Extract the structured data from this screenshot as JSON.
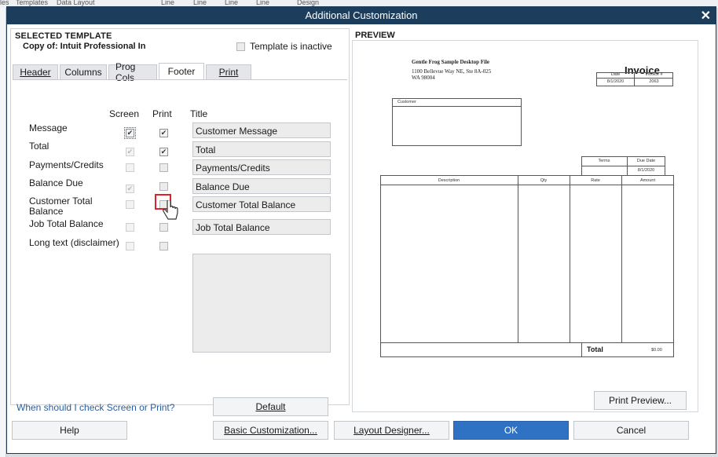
{
  "background_app": {
    "menu_items": [
      "les",
      "Templates",
      "Data Layout",
      "Line",
      "Line",
      "Line",
      "Line"
    ],
    "design_label": "Design"
  },
  "dialog": {
    "title": "Additional Customization",
    "close_glyph": "✕"
  },
  "selected_template": {
    "heading": "SELECTED TEMPLATE",
    "copy_of": "Copy of: Intuit Professional In",
    "inactive_label": "Template is inactive",
    "inactive_checked": false
  },
  "tabs": [
    {
      "label": "Header",
      "active": false
    },
    {
      "label": "Columns",
      "active": false
    },
    {
      "label": "Prog Cols",
      "active": false
    },
    {
      "label": "Footer",
      "active": true
    },
    {
      "label": "Print",
      "active": false
    }
  ],
  "footer": {
    "col_screen": "Screen",
    "col_print": "Print",
    "col_title": "Title",
    "rows": [
      {
        "label": "Message",
        "screen": true,
        "print": true,
        "title": "Customer Message"
      },
      {
        "label": "Total",
        "screen": true,
        "print": true,
        "title": "Total"
      },
      {
        "label": "Payments/Credits",
        "screen": false,
        "print": false,
        "title": "Payments/Credits"
      },
      {
        "label": "Balance Due",
        "screen": true,
        "print": false,
        "title": "Balance Due"
      },
      {
        "label": "Customer Total\nBalance",
        "screen": false,
        "print": false,
        "title": "Customer Total Balance"
      },
      {
        "label": "Job Total Balance",
        "screen": false,
        "print": false,
        "title": "Job Total Balance"
      },
      {
        "label": "Long text (disclaimer)",
        "screen": false,
        "print": false,
        "title": ""
      }
    ]
  },
  "help_link": "When should I check Screen or Print?",
  "buttons": {
    "default": "Default",
    "help": "Help",
    "basic": "Basic Customization...",
    "layout": "Layout Designer...",
    "ok": "OK",
    "cancel": "Cancel",
    "print_preview": "Print Preview..."
  },
  "preview": {
    "heading": "PREVIEW",
    "company_name": "Gentle Frog Sample Desktop File",
    "company_addr1": "1100 Bellevue Way NE, Ste 8A-025",
    "company_addr2": "WA 98004",
    "doc_title": "Invoice",
    "date_label": "Date",
    "invoice_no_label": "Invoice #",
    "date_value": "8/1/2020",
    "invoice_no_value": "2063",
    "customer_label": "Customer",
    "terms_label": "Terms",
    "due_date_label": "Due Date",
    "due_date_value": "8/1/2020",
    "col_description": "Description",
    "col_qty": "Qty",
    "col_rate": "Rate",
    "col_amount": "Amount",
    "total_label": "Total",
    "total_value": "$0.00"
  },
  "colors": {
    "titlebar": "#1c3d5c",
    "ok_button": "#2f72c4",
    "highlight_box": "#e0202a",
    "link": "#2a5d9f"
  }
}
